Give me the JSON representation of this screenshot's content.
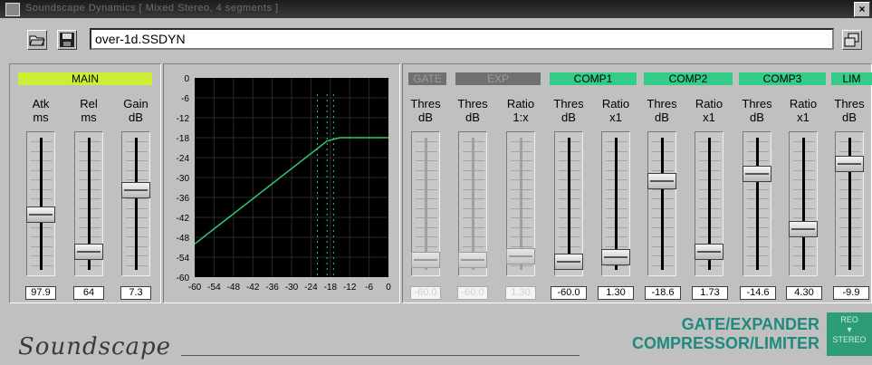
{
  "window": {
    "title": "Soundscape Dynamics  [ Mixed Stereo, 4 segments ]"
  },
  "toolbar": {
    "filename": "over-1d.SSDYN"
  },
  "main": {
    "header": "MAIN",
    "faders": [
      {
        "label1": "Atk",
        "label2": "ms",
        "value": "97.9",
        "level": 0.42
      },
      {
        "label1": "Rel",
        "label2": "ms",
        "value": "64",
        "level": 0.12
      },
      {
        "label1": "Gain",
        "label2": "dB",
        "value": "7.3",
        "level": 0.62
      }
    ]
  },
  "graph": {
    "y_ticks": [
      "0",
      "-6",
      "-12",
      "-18",
      "-24",
      "-30",
      "-36",
      "-42",
      "-48",
      "-54",
      "-60"
    ],
    "x_ticks": [
      "-60",
      "-54",
      "-48",
      "-42",
      "-36",
      "-30",
      "-24",
      "-18",
      "-12",
      "-6",
      "0"
    ]
  },
  "sections": {
    "gate": {
      "header": "GATE",
      "fader": {
        "label1": "Thres",
        "label2": "dB",
        "value": "-60.0",
        "level": 0.05
      }
    },
    "exp": {
      "header": "EXP",
      "faders": [
        {
          "label1": "Thres",
          "label2": "dB",
          "value": "-60.0",
          "level": 0.05
        },
        {
          "label1": "Ratio",
          "label2": "1:x",
          "value": "1.30",
          "level": 0.08
        }
      ]
    },
    "comp1": {
      "header": "COMP1",
      "faders": [
        {
          "label1": "Thres",
          "label2": "dB",
          "value": "-60.0",
          "level": 0.04
        },
        {
          "label1": "Ratio",
          "label2": "x1",
          "value": "1.30",
          "level": 0.07
        }
      ]
    },
    "comp2": {
      "header": "COMP2",
      "faders": [
        {
          "label1": "Thres",
          "label2": "dB",
          "value": "-18.6",
          "level": 0.69
        },
        {
          "label1": "Ratio",
          "label2": "x1",
          "value": "1.73",
          "level": 0.12
        }
      ]
    },
    "comp3": {
      "header": "COMP3",
      "faders": [
        {
          "label1": "Thres",
          "label2": "dB",
          "value": "-14.6",
          "level": 0.75
        },
        {
          "label1": "Ratio",
          "label2": "x1",
          "value": "4.30",
          "level": 0.3
        }
      ]
    },
    "lim": {
      "header": "LIM",
      "fader": {
        "label1": "Thres",
        "label2": "dB",
        "value": "-9.9",
        "level": 0.83
      }
    }
  },
  "footer": {
    "brand": "Soundscape",
    "title_line1": "GATE/EXPANDER",
    "title_line2": "COMPRESSOR/LIMITER",
    "badge_line1": "REO",
    "badge_line2": "STEREO"
  },
  "colors": {
    "active_header": "#33cc88",
    "main_header": "#ccee33",
    "inactive_header": "#707070",
    "curve": "#2ecc71",
    "graph_bg": "#000000"
  }
}
